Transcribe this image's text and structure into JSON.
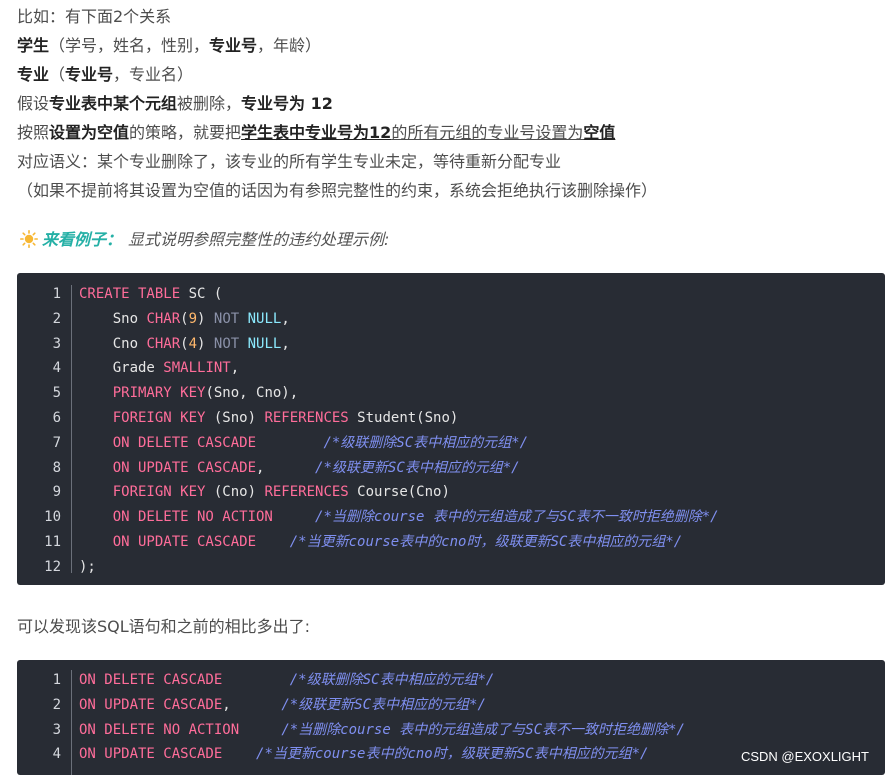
{
  "paragraphs": {
    "p1": "比如：有下面2个关系",
    "p2_student": "学生",
    "p2_a": "（学号，姓名，性别，",
    "p2_major_no": "专业号",
    "p2_b": "，年龄）",
    "p3_major": "专业",
    "p3_a": "（",
    "p3_major_no": "专业号",
    "p3_b": "，专业名）",
    "p4_a": "假设",
    "p4_b": "专业表中某个元组",
    "p4_c": "被删除，",
    "p4_d": "专业号为 12",
    "p5_a": "按照",
    "p5_b": "设置为空值",
    "p5_c": "的策略，就要把",
    "p5_d": "学生表中专业号为12",
    "p5_e": "的所有元组的专业号设置为",
    "p5_f": "空值",
    "p6": "对应语义：某个专业删除了，该专业的所有学生专业未定，等待重新分配专业",
    "p7": "（如果不提前将其设置为空值的话因为有参照完整性的约束，系统会拒绝执行该删除操作）",
    "example_lead": "来看例子：",
    "example_desc": "显式说明参照完整性的违约处理示例:",
    "p8": "可以发现该SQL语句和之前的相比多出了:"
  },
  "icons": {
    "example": "sun-icon"
  },
  "colors": {
    "code_bg": "#282c34",
    "keyword": "#ff6d9a",
    "number": "#ffb86c",
    "comment": "#7f8ff0",
    "null": "#8be9fd",
    "accent": "#25b0a6"
  },
  "code1": {
    "line_numbers": [
      "1",
      "2",
      "3",
      "4",
      "5",
      "6",
      "7",
      "8",
      "9",
      "10",
      "11",
      "12"
    ],
    "lines": [
      [
        {
          "t": "k",
          "v": "CREATE TABLE"
        },
        {
          "t": "w",
          "v": " SC ("
        }
      ],
      [
        {
          "t": "w",
          "v": "    Sno "
        },
        {
          "t": "k",
          "v": "CHAR"
        },
        {
          "t": "w",
          "v": "("
        },
        {
          "t": "n",
          "v": "9"
        },
        {
          "t": "w",
          "v": ") "
        },
        {
          "t": "g",
          "v": "NOT"
        },
        {
          "t": "w",
          "v": " "
        },
        {
          "t": "cy",
          "v": "NULL"
        },
        {
          "t": "w",
          "v": ","
        }
      ],
      [
        {
          "t": "w",
          "v": "    Cno "
        },
        {
          "t": "k",
          "v": "CHAR"
        },
        {
          "t": "w",
          "v": "("
        },
        {
          "t": "n",
          "v": "4"
        },
        {
          "t": "w",
          "v": ") "
        },
        {
          "t": "g",
          "v": "NOT"
        },
        {
          "t": "w",
          "v": " "
        },
        {
          "t": "cy",
          "v": "NULL"
        },
        {
          "t": "w",
          "v": ","
        }
      ],
      [
        {
          "t": "w",
          "v": "    Grade "
        },
        {
          "t": "k",
          "v": "SMALLINT"
        },
        {
          "t": "w",
          "v": ","
        }
      ],
      [
        {
          "t": "w",
          "v": "    "
        },
        {
          "t": "k",
          "v": "PRIMARY KEY"
        },
        {
          "t": "w",
          "v": "(Sno, Cno),"
        }
      ],
      [
        {
          "t": "w",
          "v": "    "
        },
        {
          "t": "k",
          "v": "FOREIGN KEY"
        },
        {
          "t": "w",
          "v": " (Sno) "
        },
        {
          "t": "k",
          "v": "REFERENCES"
        },
        {
          "t": "w",
          "v": " Student(Sno)"
        }
      ],
      [
        {
          "t": "w",
          "v": "    "
        },
        {
          "t": "k",
          "v": "ON DELETE CASCADE"
        },
        {
          "t": "w",
          "v": "        "
        },
        {
          "t": "c",
          "v": "/*级联删除SC表中相应的元组*/"
        }
      ],
      [
        {
          "t": "w",
          "v": "    "
        },
        {
          "t": "k",
          "v": "ON UPDATE CASCADE"
        },
        {
          "t": "w",
          "v": ",      "
        },
        {
          "t": "c",
          "v": "/*级联更新SC表中相应的元组*/"
        }
      ],
      [
        {
          "t": "w",
          "v": "    "
        },
        {
          "t": "k",
          "v": "FOREIGN KEY"
        },
        {
          "t": "w",
          "v": " (Cno) "
        },
        {
          "t": "k",
          "v": "REFERENCES"
        },
        {
          "t": "w",
          "v": " Course(Cno)"
        }
      ],
      [
        {
          "t": "w",
          "v": "    "
        },
        {
          "t": "k",
          "v": "ON DELETE NO ACTION"
        },
        {
          "t": "w",
          "v": "     "
        },
        {
          "t": "c",
          "v": "/*当删除course 表中的元组造成了与SC表不一致时拒绝删除*/"
        }
      ],
      [
        {
          "t": "w",
          "v": "    "
        },
        {
          "t": "k",
          "v": "ON UPDATE CASCADE"
        },
        {
          "t": "w",
          "v": "    "
        },
        {
          "t": "c",
          "v": "/*当更新course表中的cno时，级联更新SC表中相应的元组*/"
        }
      ],
      [
        {
          "t": "w",
          "v": ");"
        }
      ]
    ]
  },
  "code2": {
    "line_numbers": [
      "1",
      "2",
      "3",
      "4"
    ],
    "lines": [
      [
        {
          "t": "k",
          "v": "ON DELETE CASCADE"
        },
        {
          "t": "w",
          "v": "        "
        },
        {
          "t": "c",
          "v": "/*级联删除SC表中相应的元组*/"
        }
      ],
      [
        {
          "t": "k",
          "v": "ON UPDATE CASCADE"
        },
        {
          "t": "w",
          "v": ",      "
        },
        {
          "t": "c",
          "v": "/*级联更新SC表中相应的元组*/"
        }
      ],
      [
        {
          "t": "k",
          "v": "ON DELETE NO ACTION"
        },
        {
          "t": "w",
          "v": "     "
        },
        {
          "t": "c",
          "v": "/*当删除course 表中的元组造成了与SC表不一致时拒绝删除*/"
        }
      ],
      [
        {
          "t": "k",
          "v": "ON UPDATE CASCADE"
        },
        {
          "t": "w",
          "v": "    "
        },
        {
          "t": "c",
          "v": "/*当更新course表中的cno时，级联更新SC表中相应的元组*/"
        }
      ]
    ]
  },
  "watermark": "CSDN @EXOXLIGHT"
}
